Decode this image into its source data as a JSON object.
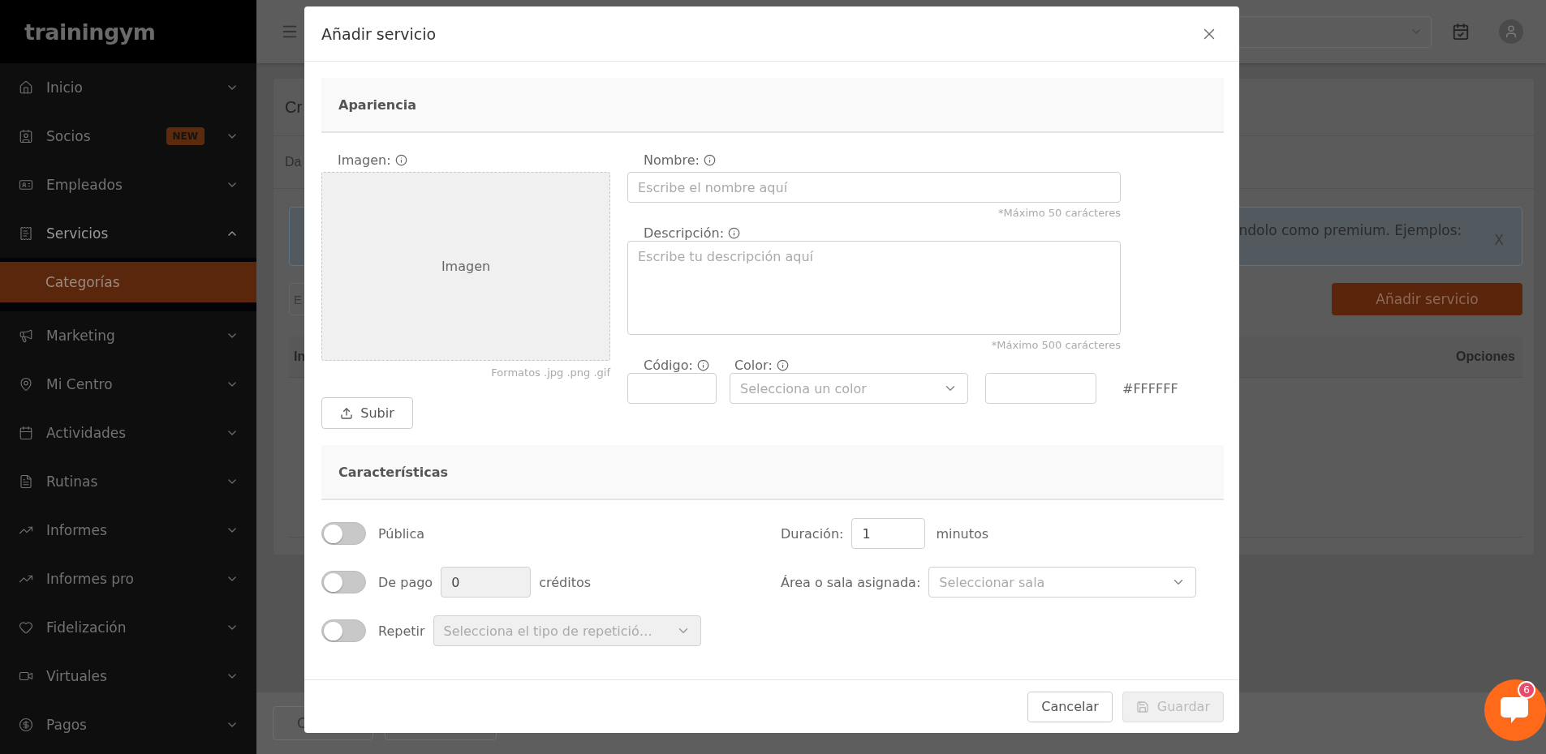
{
  "sidebar": {
    "logo": "trainingym",
    "items": [
      {
        "label": "Inicio",
        "expanded": false
      },
      {
        "label": "Socios",
        "badge": "NEW",
        "expanded": false
      },
      {
        "label": "Empleados",
        "expanded": false
      },
      {
        "label": "Servicios",
        "expanded": true,
        "children": [
          {
            "label": "Categorías",
            "selected": true
          }
        ]
      },
      {
        "label": "Marketing",
        "expanded": false
      },
      {
        "label": "Mi Centro",
        "expanded": false
      },
      {
        "label": "Actividades",
        "expanded": false
      },
      {
        "label": "Rutinas",
        "expanded": false
      },
      {
        "label": "Informes",
        "expanded": false
      },
      {
        "label": "Informes pro",
        "expanded": false
      },
      {
        "label": "Fidelización",
        "expanded": false
      },
      {
        "label": "Virtuales",
        "expanded": false
      },
      {
        "label": "Pagos",
        "expanded": false
      }
    ]
  },
  "page": {
    "title": "Cr",
    "tab": "Da",
    "alert": {
      "text": "ndolo como premium. Ejemplos:",
      "close": "X"
    },
    "search": {
      "placeholder": "E"
    },
    "add_button": "Añadir servicio",
    "table": {
      "columns": [
        "In",
        "Opciones"
      ]
    },
    "footer_buttons": [
      "C"
    ]
  },
  "chat": {
    "badge": "6"
  },
  "modal": {
    "title": "Añadir servicio",
    "appearance": {
      "title": "Apariencia",
      "image": {
        "label": "Imagen:",
        "placeholder": "Imagen",
        "formats": "Formatos .jpg .png .gif",
        "upload": "Subir"
      },
      "name": {
        "label": "Nombre:",
        "placeholder": "Escribe el nombre aquí",
        "hint": "*Máximo 50 carácteres"
      },
      "description": {
        "label": "Descripción:",
        "placeholder": "Escribe tu descripción aquí",
        "hint": "*Máximo 500 carácteres"
      },
      "code": {
        "label": "Código:"
      },
      "color": {
        "label": "Color:",
        "placeholder": "Selecciona un color",
        "hex": "#FFFFFF"
      }
    },
    "features": {
      "title": "Características",
      "toggles": [
        {
          "kind": "plain",
          "label": "Pública",
          "on": false
        },
        {
          "kind": "credits",
          "label": "De pago",
          "on": false,
          "value": "0",
          "unit": "créditos",
          "disabled": true
        },
        {
          "kind": "select",
          "label": "Repetir",
          "on": false,
          "placeholder": "Selecciona el tipo de repetició…",
          "disabled": true
        }
      ],
      "duration": {
        "label": "Duración:",
        "value": "1",
        "unit": "minutos"
      },
      "area": {
        "label": "Área o sala asignada:",
        "placeholder": "Seleccionar sala"
      }
    },
    "buttons": [
      {
        "kind": "cancel",
        "label": "Cancelar",
        "disabled": false
      },
      {
        "kind": "save",
        "label": "Guardar",
        "disabled": true
      }
    ]
  }
}
